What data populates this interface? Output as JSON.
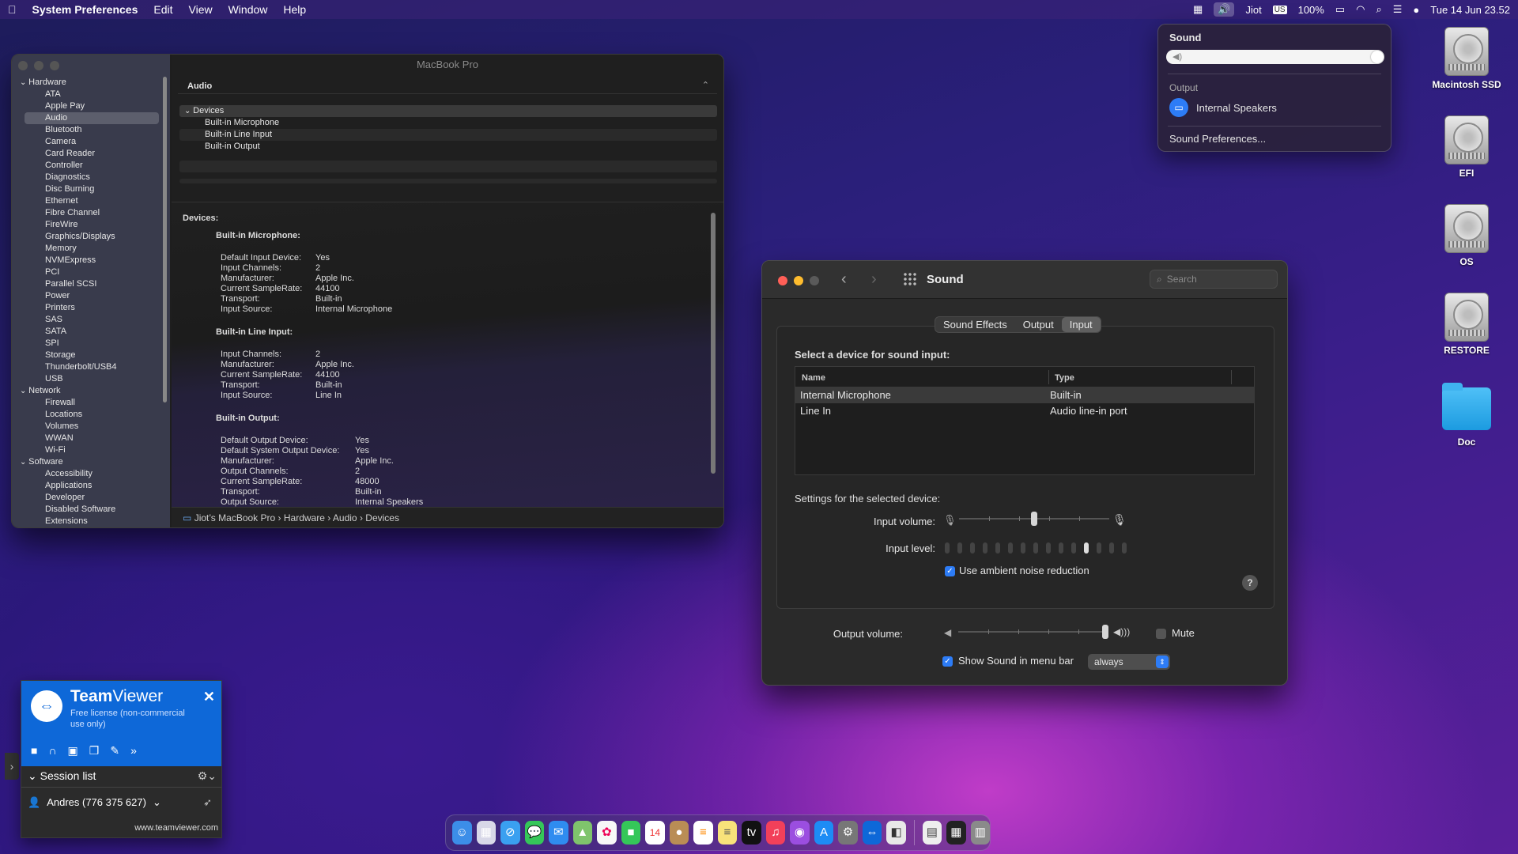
{
  "menubar": {
    "app": "System Preferences",
    "menus": [
      "Edit",
      "View",
      "Window",
      "Help"
    ],
    "user": "Jiot",
    "input": "US",
    "battery": "100%",
    "datetime": "Tue 14 Jun  23.52"
  },
  "sound_popover": {
    "title": "Sound",
    "output_label": "Output",
    "device": "Internal Speakers",
    "prefs_link": "Sound Preferences..."
  },
  "desktop": {
    "items": [
      "Macintosh SSD",
      "EFI",
      "OS",
      "RESTORE",
      "Doc"
    ]
  },
  "sysinfo": {
    "title": "MacBook Pro",
    "section": "Audio",
    "tree": [
      {
        "t": "cat",
        "l": "Hardware"
      },
      {
        "t": "item",
        "l": "ATA"
      },
      {
        "t": "item",
        "l": "Apple Pay"
      },
      {
        "t": "item",
        "l": "Audio",
        "sel": true
      },
      {
        "t": "item",
        "l": "Bluetooth"
      },
      {
        "t": "item",
        "l": "Camera"
      },
      {
        "t": "item",
        "l": "Card Reader"
      },
      {
        "t": "item",
        "l": "Controller"
      },
      {
        "t": "item",
        "l": "Diagnostics"
      },
      {
        "t": "item",
        "l": "Disc Burning"
      },
      {
        "t": "item",
        "l": "Ethernet"
      },
      {
        "t": "item",
        "l": "Fibre Channel"
      },
      {
        "t": "item",
        "l": "FireWire"
      },
      {
        "t": "item",
        "l": "Graphics/Displays"
      },
      {
        "t": "item",
        "l": "Memory"
      },
      {
        "t": "item",
        "l": "NVMExpress"
      },
      {
        "t": "item",
        "l": "PCI"
      },
      {
        "t": "item",
        "l": "Parallel SCSI"
      },
      {
        "t": "item",
        "l": "Power"
      },
      {
        "t": "item",
        "l": "Printers"
      },
      {
        "t": "item",
        "l": "SAS"
      },
      {
        "t": "item",
        "l": "SATA"
      },
      {
        "t": "item",
        "l": "SPI"
      },
      {
        "t": "item",
        "l": "Storage"
      },
      {
        "t": "item",
        "l": "Thunderbolt/USB4"
      },
      {
        "t": "item",
        "l": "USB"
      },
      {
        "t": "cat",
        "l": "Network"
      },
      {
        "t": "item",
        "l": "Firewall"
      },
      {
        "t": "item",
        "l": "Locations"
      },
      {
        "t": "item",
        "l": "Volumes"
      },
      {
        "t": "item",
        "l": "WWAN"
      },
      {
        "t": "item",
        "l": "Wi-Fi"
      },
      {
        "t": "cat",
        "l": "Software"
      },
      {
        "t": "item",
        "l": "Accessibility"
      },
      {
        "t": "item",
        "l": "Applications"
      },
      {
        "t": "item",
        "l": "Developer"
      },
      {
        "t": "item",
        "l": "Disabled Software"
      },
      {
        "t": "item",
        "l": "Extensions"
      }
    ],
    "device_header": "Devices",
    "device_rows": [
      "Built-in Microphone",
      "Built-in Line Input",
      "Built-in Output"
    ],
    "details": {
      "heading": "Devices:",
      "groups": [
        {
          "name": "Built-in Microphone:",
          "kv": [
            [
              "Default Input Device:",
              "Yes"
            ],
            [
              "Input Channels:",
              "2"
            ],
            [
              "Manufacturer:",
              "Apple Inc."
            ],
            [
              "Current SampleRate:",
              "44100"
            ],
            [
              "Transport:",
              "Built-in"
            ],
            [
              "Input Source:",
              "Internal Microphone"
            ]
          ]
        },
        {
          "name": "Built-in Line Input:",
          "kv": [
            [
              "Input Channels:",
              "2"
            ],
            [
              "Manufacturer:",
              "Apple Inc."
            ],
            [
              "Current SampleRate:",
              "44100"
            ],
            [
              "Transport:",
              "Built-in"
            ],
            [
              "Input Source:",
              "Line In"
            ]
          ]
        },
        {
          "name": "Built-in Output:",
          "kv": [
            [
              "Default Output Device:",
              "Yes"
            ],
            [
              "Default System Output Device:",
              "Yes"
            ],
            [
              "Manufacturer:",
              "Apple Inc."
            ],
            [
              "Output Channels:",
              "2"
            ],
            [
              "Current SampleRate:",
              "48000"
            ],
            [
              "Transport:",
              "Built-in"
            ],
            [
              "Output Source:",
              "Internal Speakers"
            ]
          ]
        }
      ]
    },
    "path": [
      "Jiot’s MacBook Pro",
      "Hardware",
      "Audio",
      "Devices"
    ]
  },
  "sound": {
    "title": "Sound",
    "search_placeholder": "Search",
    "tabs": [
      "Sound Effects",
      "Output",
      "Input"
    ],
    "select_label": "Select a device for sound input:",
    "col_name": "Name",
    "col_type": "Type",
    "rows": [
      [
        "Internal Microphone",
        "Built-in"
      ],
      [
        "Line In",
        "Audio line-in port"
      ]
    ],
    "settings_label": "Settings for the selected device:",
    "input_volume_label": "Input volume:",
    "input_volume": 0.5,
    "input_level_label": "Input level:",
    "input_level_active": 12,
    "input_level_total": 15,
    "noise_label": "Use ambient noise reduction",
    "output_volume_label": "Output volume:",
    "output_volume": 1.0,
    "mute_label": "Mute",
    "show_menu_label": "Show Sound in menu bar",
    "show_menu_value": "always"
  },
  "teamviewer": {
    "brand1": "Team",
    "brand2": "Viewer",
    "license": "Free license (non-commercial use only)",
    "session_list": "Session list",
    "account": "Andres (776 375 627)",
    "url": "www.teamviewer.com"
  }
}
